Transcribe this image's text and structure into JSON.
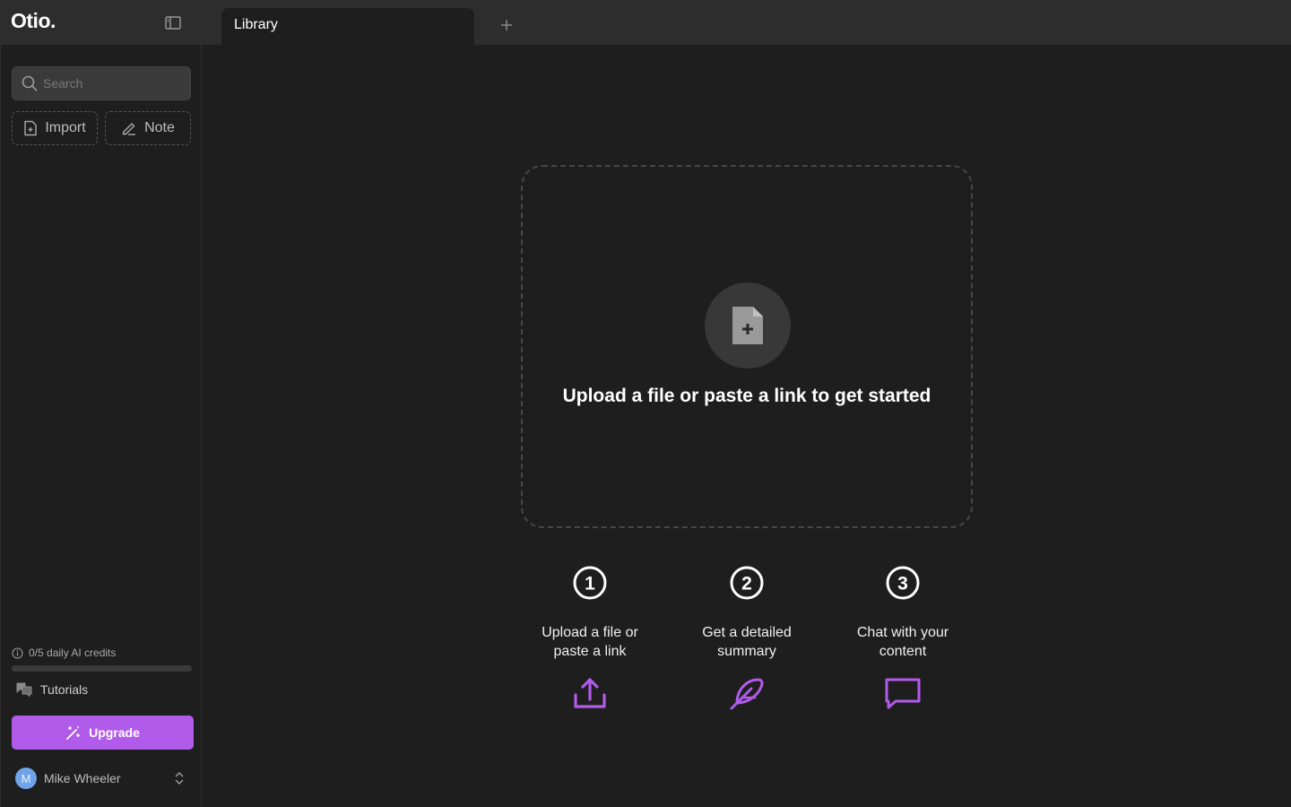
{
  "app": {
    "logo": "Otio.",
    "tab_title": "Library"
  },
  "sidebar": {
    "search_placeholder": "Search",
    "import_label": "Import",
    "note_label": "Note",
    "credits_text": "0/5 daily AI credits",
    "credits_used": 0,
    "credits_total": 5,
    "tutorials_label": "Tutorials",
    "upgrade_label": "Upgrade",
    "user_initial": "M",
    "user_name": "Mike Wheeler"
  },
  "main": {
    "dropzone_text": "Upload a file or paste a link to get started",
    "steps": [
      {
        "number": "1",
        "label_line1": "Upload a file or",
        "label_line2": "paste a link",
        "icon": "upload-icon"
      },
      {
        "number": "2",
        "label_line1": "Get a detailed",
        "label_line2": "summary",
        "icon": "feather-icon"
      },
      {
        "number": "3",
        "label_line1": "Chat with your",
        "label_line2": "content",
        "icon": "chat-icon"
      }
    ]
  },
  "colors": {
    "accent": "#b15bea",
    "background": "#1e1e1e",
    "topbar": "#2d2d2d"
  }
}
